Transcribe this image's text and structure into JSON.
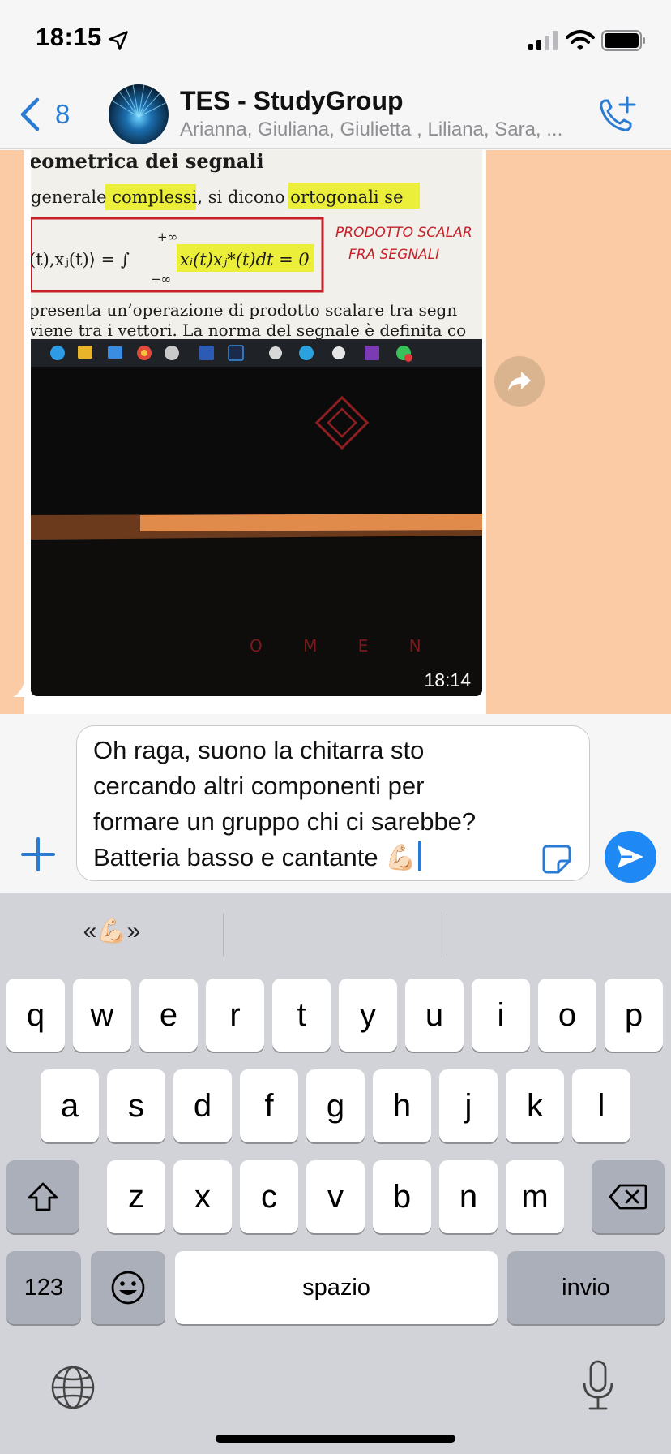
{
  "status_bar": {
    "time": "18:15"
  },
  "header": {
    "back_count": "8",
    "title": "TES - StudyGroup",
    "subtitle": "Arianna, Giuliana, Giulietta , Liliana, Sara, ..."
  },
  "message": {
    "time": "18:14",
    "photo_text": {
      "heading": "eometrica dei segnali",
      "line1": "generale complessi, si dicono ortogonali se",
      "formula_left": "(t),xⱼ(t)⟩ = ∫",
      "formula_right": "xᵢ(t)xⱼ*(t)dt = 0",
      "upper": "+∞",
      "lower": "−∞",
      "note1": "PRODOTTO SCALAR",
      "note2": "FRA SEGNALI",
      "para1": "presenta un’operazione di prodotto scalare tra segn",
      "para2": "viene tra i vettori. La norma del segnale è definita co",
      "brand": "O M E N"
    }
  },
  "composer": {
    "text": "Oh raga, suono la chitarra sto\ncercando altri componenti per\nformare un gruppo chi ci sarebbe?\nBatteria basso e cantante 💪🏻"
  },
  "keyboard": {
    "suggestions": [
      "«💪🏻»",
      "",
      ""
    ],
    "row1": [
      "q",
      "w",
      "e",
      "r",
      "t",
      "y",
      "u",
      "i",
      "o",
      "p"
    ],
    "row2": [
      "a",
      "s",
      "d",
      "f",
      "g",
      "h",
      "j",
      "k",
      "l"
    ],
    "row3": [
      "z",
      "x",
      "c",
      "v",
      "b",
      "n",
      "m"
    ],
    "numbers_label": "123",
    "space_label": "spazio",
    "return_label": "invio"
  },
  "colors": {
    "accent": "#2a7bd3",
    "send": "#1e88f5",
    "wallpaper": "#fbcba6",
    "forward": "#d9b48f"
  }
}
